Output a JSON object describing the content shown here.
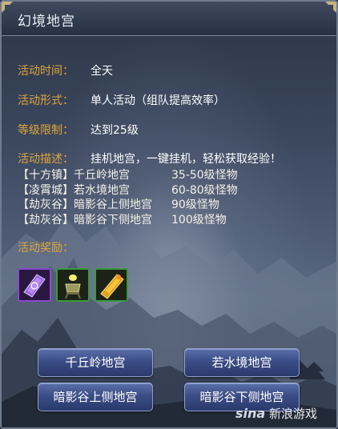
{
  "window": {
    "title": "幻境地宫"
  },
  "info": {
    "time_label": "活动时间：",
    "time_value": "全天",
    "form_label": "活动形式：",
    "form_value": "单人活动（组队提高效率）",
    "level_label": "等级限制：",
    "level_value": "达到25级",
    "desc_label": "活动描述：",
    "desc_text": "挂机地宫，一键挂机，轻松获取经验！"
  },
  "locations": [
    {
      "place": "【十方镇】千丘岭地宫",
      "level": "35-50级怪物"
    },
    {
      "place": "【凌霄城】若水境地宫",
      "level": "60-80级怪物"
    },
    {
      "place": "【劫灰谷】暗影谷上侧地宫",
      "level": "90级怪物"
    },
    {
      "place": "【劫灰谷】暗影谷下侧地宫",
      "level": "100级怪物"
    }
  ],
  "rewards": {
    "label": "活动奖励：",
    "items": [
      {
        "icon": "purple-scroll-icon",
        "rarity_color": "#8a4ad0"
      },
      {
        "icon": "incense-burner-icon",
        "rarity_color": "#3a9a3a"
      },
      {
        "icon": "golden-talisman-icon",
        "rarity_color": "#3a9a3a"
      }
    ]
  },
  "buttons": {
    "b1": "千丘岭地宫",
    "b2": "若水境地宫",
    "b3": "暗影谷上侧地宫",
    "b4": "暗影谷下侧地宫"
  },
  "watermark": {
    "brand": "sina",
    "text": "新浪游戏"
  },
  "colors": {
    "label": "#e0a43a",
    "button": "#3b4d86",
    "text": "#ffffff"
  }
}
